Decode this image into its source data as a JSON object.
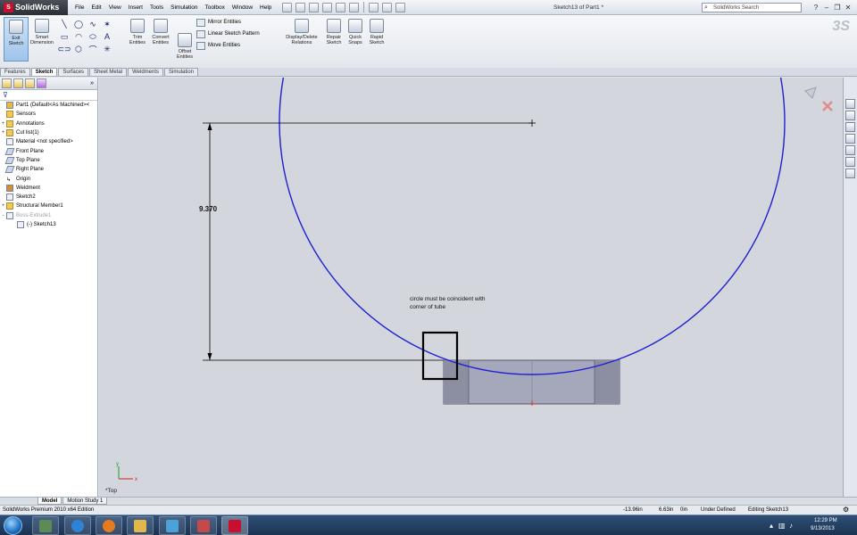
{
  "app": {
    "name": "SolidWorks",
    "document_title": "Sketch13 of Part1 *",
    "menu": [
      "File",
      "Edit",
      "View",
      "Insert",
      "Tools",
      "Simulation",
      "Toolbox",
      "Window",
      "Help"
    ],
    "search_placeholder": "SolidWorks Search",
    "window_controls": [
      "?",
      "–",
      "❐",
      "✕"
    ]
  },
  "command_manager": {
    "exit_sketch": "Exit Sketch",
    "smart_dimension": "Smart Dimension",
    "trim_entities": "Trim Entities",
    "convert_entities": "Convert Entities",
    "offset_entities": "Offset Entities",
    "mirror_entities": "Mirror Entities",
    "linear_sketch_pattern": "Linear Sketch Pattern",
    "move_entities": "Move Entities",
    "display_delete_relations": "Display/Delete Relations",
    "repair_sketch": "Repair Sketch",
    "quick_snaps": "Quick Snaps",
    "rapid_sketch": "Rapid Sketch"
  },
  "tabs": [
    "Features",
    "Sketch",
    "Surfaces",
    "Sheet Metal",
    "Weldments",
    "Simulation"
  ],
  "active_tab": "Sketch",
  "feature_tree": [
    {
      "label": "Part1  (Default<As Machined><",
      "icon": "part-icon",
      "expand": "",
      "grey": false
    },
    {
      "label": "Sensors",
      "icon": "sensors-icon",
      "expand": "",
      "grey": false
    },
    {
      "label": "Annotations",
      "icon": "annotations-icon",
      "expand": "+",
      "grey": false
    },
    {
      "label": "Cut list(1)",
      "icon": "cut-list-icon",
      "expand": "+",
      "grey": false
    },
    {
      "label": "Material <not specified>",
      "icon": "material-icon",
      "expand": "",
      "grey": false
    },
    {
      "label": "Front Plane",
      "icon": "plane-icon",
      "expand": "",
      "grey": false
    },
    {
      "label": "Top Plane",
      "icon": "plane-icon",
      "expand": "",
      "grey": false
    },
    {
      "label": "Right Plane",
      "icon": "plane-icon",
      "expand": "",
      "grey": false
    },
    {
      "label": "Origin",
      "icon": "origin-icon",
      "expand": "",
      "grey": false
    },
    {
      "label": "Weldment",
      "icon": "weldment-icon",
      "expand": "",
      "grey": false
    },
    {
      "label": "Sketch2",
      "icon": "sketch-icon",
      "expand": "",
      "grey": false
    },
    {
      "label": "Structural Member1",
      "icon": "structural-member-icon",
      "expand": "+",
      "grey": false
    },
    {
      "label": "Boss-Extrude1",
      "icon": "extrude-icon",
      "expand": "-",
      "grey": true
    },
    {
      "label": "(-) Sketch13",
      "icon": "sketch-icon",
      "expand": "",
      "grey": false
    }
  ],
  "graphics": {
    "annotation": "circle must be coincident with corner of tube",
    "dimension": "9.370",
    "view_label": "*Top"
  },
  "bottom_tabs": [
    "Model",
    "Motion Study 1"
  ],
  "status": {
    "edition": "SolidWorks Premium 2010 x64 Edition",
    "x": "-13.96in",
    "y": "6.63in",
    "z": "0in",
    "state": "Under Defined",
    "editing": "Editing Sketch13"
  },
  "taskbar": {
    "time": "12:29 PM",
    "date": "9/13/2013"
  }
}
